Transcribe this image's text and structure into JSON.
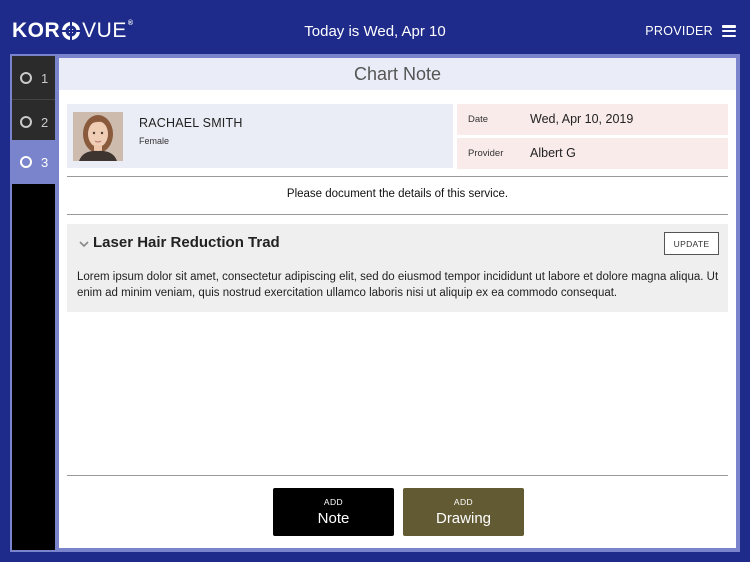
{
  "header": {
    "logo_text_left": "KOR",
    "logo_text_right": "VUE",
    "logo_mark": "®",
    "date_title": "Today is Wed, Apr 10",
    "provider_label": "PROVIDER",
    "menu_icon": "hamburger-icon"
  },
  "sidebar": {
    "steps": [
      {
        "label": "1",
        "icon": "circle-icon"
      },
      {
        "label": "2",
        "icon": "circle-icon"
      },
      {
        "label": "3",
        "icon": "circle-icon"
      }
    ],
    "active_color": "#7a84cc"
  },
  "main": {
    "title": "Chart Note",
    "patient": {
      "name": "RACHAEL SMITH",
      "sex": "Female"
    },
    "info": {
      "date_label": "Date",
      "date_value": "Wed, Apr 10, 2019",
      "provider_label": "Provider",
      "provider_value": "Albert G"
    },
    "instructions": "Please document the details of this service.",
    "service": {
      "name": "Laser Hair Reduction Trad",
      "update_label": "UPDATE",
      "text": "Lorem ipsum dolor sit amet, consectetur adipiscing elit, sed do eiusmod tempor incididunt ut labore et dolore magna aliqua. Ut enim ad minim veniam, quis nostrud exercitation ullamco laboris nisi ut aliquip ex ea commodo consequat."
    },
    "buttons": {
      "note_small": "ADD",
      "note_big": "Note",
      "drawing_small": "ADD",
      "drawing_big": "Drawing"
    }
  },
  "colors": {
    "brand_blue": "#1f2b8a",
    "frame": "#7a84cc",
    "drawing_button": "#625a33",
    "info_bg": "#f9ebea",
    "patient_bg": "#ebedf6"
  }
}
